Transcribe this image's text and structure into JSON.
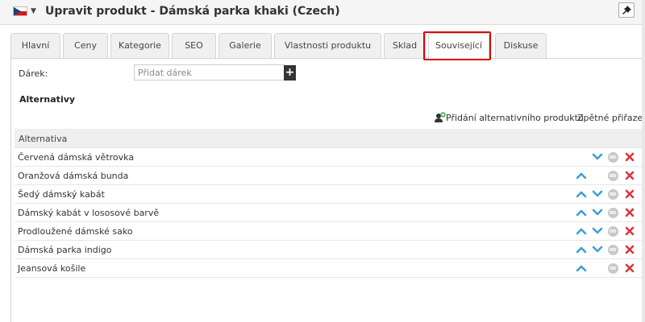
{
  "header": {
    "title": "Upravit produkt - Dámská parka khaki (Czech)",
    "flag_icon": "czech-flag-icon",
    "pin_icon": "pin-icon"
  },
  "tabs": [
    {
      "label": "Hlavní",
      "active": false
    },
    {
      "label": "Ceny",
      "active": false
    },
    {
      "label": "Kategorie",
      "active": false
    },
    {
      "label": "SEO",
      "active": false
    },
    {
      "label": "Galerie",
      "active": false
    },
    {
      "label": "Vlastnosti produktu",
      "active": false
    },
    {
      "label": "Sklad",
      "active": false
    },
    {
      "label": "Související",
      "active": true
    },
    {
      "label": "Diskuse",
      "active": false
    }
  ],
  "gift": {
    "label": "Dárek:",
    "placeholder": "Přidat dárek",
    "add_symbol": "+"
  },
  "alternatives": {
    "section_title": "Alternativy",
    "add_label": "Přidání alternativního produktu",
    "back_assign_label": "Zpětné přiřazení",
    "column_header": "Alternativa",
    "rows": [
      {
        "name": "Červená dámská větrovka",
        "up": false,
        "down": true
      },
      {
        "name": "Oranžová dámská bunda",
        "up": true,
        "down": false
      },
      {
        "name": "Šedý dámský kabát",
        "up": true,
        "down": true
      },
      {
        "name": "Dámský kabát v lososové barvě",
        "up": true,
        "down": true
      },
      {
        "name": "Prodloužené dámské sako",
        "up": true,
        "down": true
      },
      {
        "name": "Dámská parka indigo",
        "up": true,
        "down": true
      },
      {
        "name": "Jeansová košile",
        "up": true,
        "down": false
      }
    ]
  },
  "colors": {
    "arrow": "#3aa0d8",
    "delete": "#d9363e",
    "highlight": "#e00000"
  }
}
